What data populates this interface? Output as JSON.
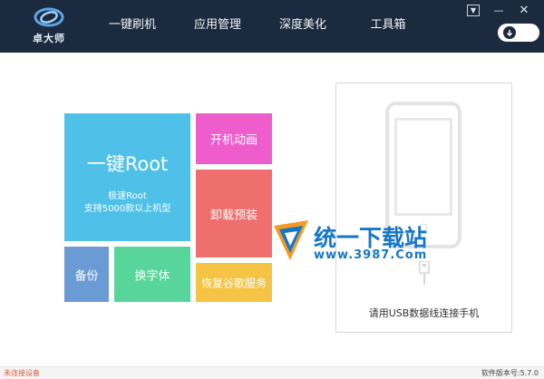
{
  "app": {
    "logo_text": "卓大师"
  },
  "nav": {
    "items": [
      "一键刷机",
      "应用管理",
      "深度美化",
      "工具箱"
    ]
  },
  "tiles": {
    "root_title": "一键Root",
    "root_line1": "极速Root",
    "root_line2": "支持5000款以上机型",
    "backup": "备份",
    "font": "换字体",
    "boot_anim": "开机动画",
    "uninstall_preinstalled": "卸载预装",
    "restore_google": "恢复谷歌服务"
  },
  "phone_panel": {
    "connect_hint": "请用USB数据线连接手机"
  },
  "watermark": {
    "title": "统一下载站",
    "url": "www.3987.Com"
  },
  "status": {
    "connection": "未连接设备",
    "version": "软件版本号:5.7.0"
  },
  "colors": {
    "titlebar": "#1b2a3f",
    "tile_root": "#4fc1e9",
    "tile_backup": "#6b9bd4",
    "tile_font": "#58d59a",
    "tile_anim": "#ef5dcc",
    "tile_preinst": "#ef6f6f",
    "tile_google": "#f6c445"
  }
}
